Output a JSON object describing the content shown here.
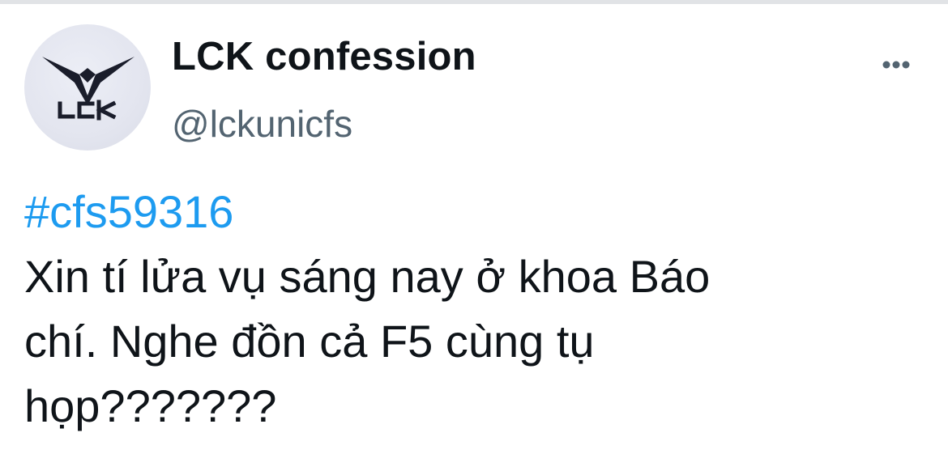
{
  "tweet": {
    "author": {
      "display_name": "LCK confession",
      "handle": "@lckunicfs",
      "avatar_text": "LCK",
      "avatar_icon": "eagle-logo-icon"
    },
    "more_icon": "more-options-icon",
    "hashtag": "#cfs59316",
    "text_lines": [
      "Xin tí lửa vụ sáng nay ở khoa Báo",
      "chí. Nghe đồn cả F5 cùng tụ",
      "họp???????"
    ]
  },
  "colors": {
    "hashtag": "#1d9bf0",
    "text": "#0f1419",
    "handle": "#536471",
    "avatar_bg": "#e3e5ef"
  }
}
